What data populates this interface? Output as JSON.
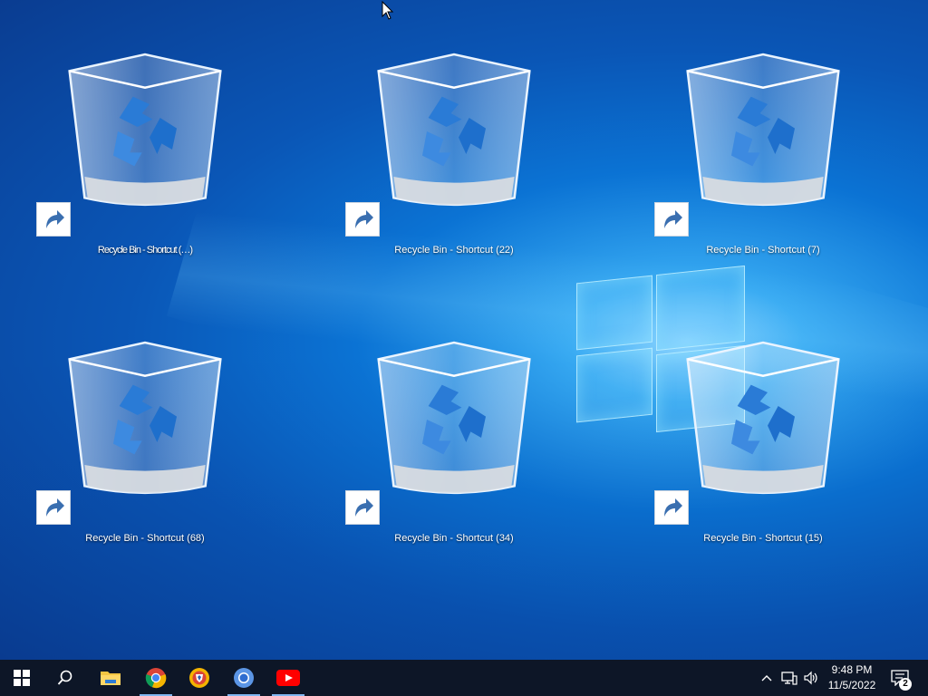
{
  "desktop": {
    "icons": [
      {
        "label": "Recycle Bin - Shortcut (…)",
        "glitched": true
      },
      {
        "label": "Recycle Bin - Shortcut (22)"
      },
      {
        "label": "Recycle Bin - Shortcut (7)"
      },
      {
        "label": "Recycle Bin - Shortcut (68)"
      },
      {
        "label": "Recycle Bin - Shortcut (34)"
      },
      {
        "label": "Recycle Bin - Shortcut (15)"
      }
    ]
  },
  "taskbar": {
    "buttons": [
      {
        "name": "start-button",
        "icon": "windows-logo-icon"
      },
      {
        "name": "search-button",
        "icon": "search-icon"
      },
      {
        "name": "file-explorer-button",
        "icon": "folder-icon"
      },
      {
        "name": "chrome-button",
        "icon": "chrome-icon"
      },
      {
        "name": "brave-button",
        "icon": "brave-icon"
      },
      {
        "name": "chromium-button",
        "icon": "chromium-icon"
      },
      {
        "name": "youtube-button",
        "icon": "youtube-icon"
      }
    ],
    "clock": {
      "time": "9:48 PM",
      "date": "11/5/2022"
    },
    "notifications_count": "2"
  },
  "colors": {
    "taskbar_bg": "#0d1627",
    "accent": "#0b73d4"
  }
}
